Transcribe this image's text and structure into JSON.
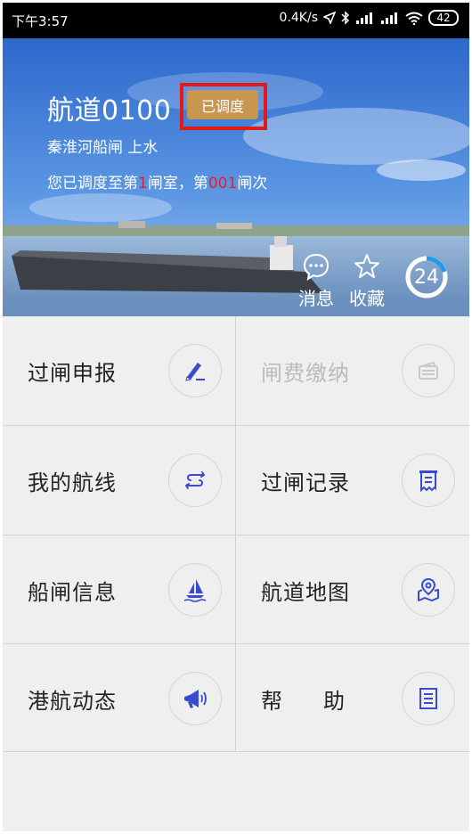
{
  "status_bar": {
    "time": "下午3:57",
    "network_speed": "0.4K/s",
    "battery": "42"
  },
  "hero": {
    "title": "航道0100",
    "status_badge": "已调度",
    "subtitle": "秦淮河船闸 上水",
    "progress": {
      "prefix": "您已调度至第",
      "chamber": "1",
      "middle": "闸室，第",
      "batch": "001",
      "suffix": "闸次"
    },
    "actions": {
      "messages_label": "消息",
      "favorites_label": "收藏"
    },
    "weather_value": "24"
  },
  "grid": {
    "items": [
      {
        "label": "过闸申报",
        "icon": "pen-icon",
        "enabled": true
      },
      {
        "label": "闸费缴纳",
        "icon": "wallet-icon",
        "enabled": false
      },
      {
        "label": "我的航线",
        "icon": "swap-arrows-icon",
        "enabled": true
      },
      {
        "label": "过闸记录",
        "icon": "receipt-icon",
        "enabled": true
      },
      {
        "label": "船闸信息",
        "icon": "sailboat-icon",
        "enabled": true
      },
      {
        "label": "航道地图",
        "icon": "map-pin-icon",
        "enabled": true
      },
      {
        "label": "港航动态",
        "icon": "megaphone-icon",
        "enabled": true
      },
      {
        "label": "帮助",
        "label_display": "帮　助",
        "icon": "document-icon",
        "enabled": true
      }
    ]
  },
  "colors": {
    "badge": "#c9964f",
    "highlight_border": "#e31818",
    "accent_red": "#e0202a",
    "icon_blue": "#3a4bd1",
    "icon_disabled": "#c8c8c8"
  }
}
